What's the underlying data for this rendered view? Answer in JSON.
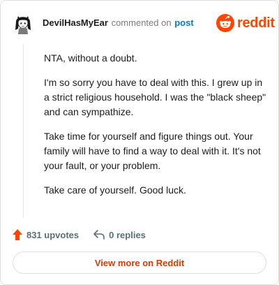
{
  "header": {
    "username": "DevilHasMyEar",
    "action_text": "commented on",
    "post_link": "post"
  },
  "brand": {
    "wordmark": "reddit",
    "icon": "reddit-logo-icon",
    "color": "#ff4500"
  },
  "comment": {
    "paragraphs": [
      "NTA, without a doubt.",
      "I'm so sorry you have to deal with this. I grew up in a strict religious household. I was the \"black sheep\" and can sympathize.",
      "Take time for yourself and figure things out. Your family will have to find a way to deal with it. It's not your fault, or your problem.",
      "Take care of yourself. Good luck."
    ]
  },
  "footer": {
    "upvotes_label": "831 upvotes",
    "upvote_icon": "upvote-arrow-icon",
    "upvote_color": "#ff4500",
    "replies_label": "0 replies",
    "reply_icon": "reply-arrow-icon"
  },
  "view_more": {
    "label": "View more on Reddit",
    "color": "#d93a00"
  }
}
